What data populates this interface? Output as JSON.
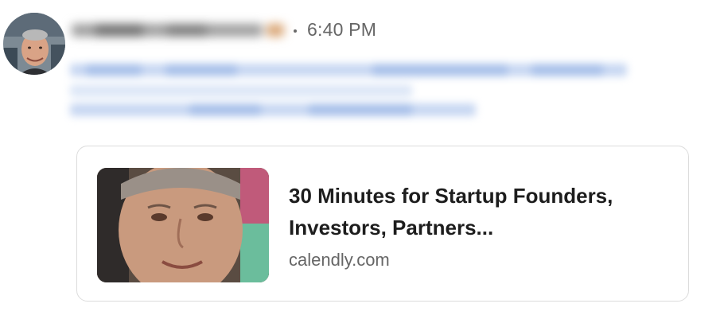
{
  "message": {
    "timestamp": "6:40 PM"
  },
  "link_preview": {
    "title": "30 Minutes for Startup Founders, Investors, Partners...",
    "domain": "calendly.com"
  },
  "colors": {
    "link_blur": "#a9c1ea",
    "card_border": "#dcdcdc",
    "meta_text": "#666666",
    "title_text": "#1d1d1d"
  }
}
